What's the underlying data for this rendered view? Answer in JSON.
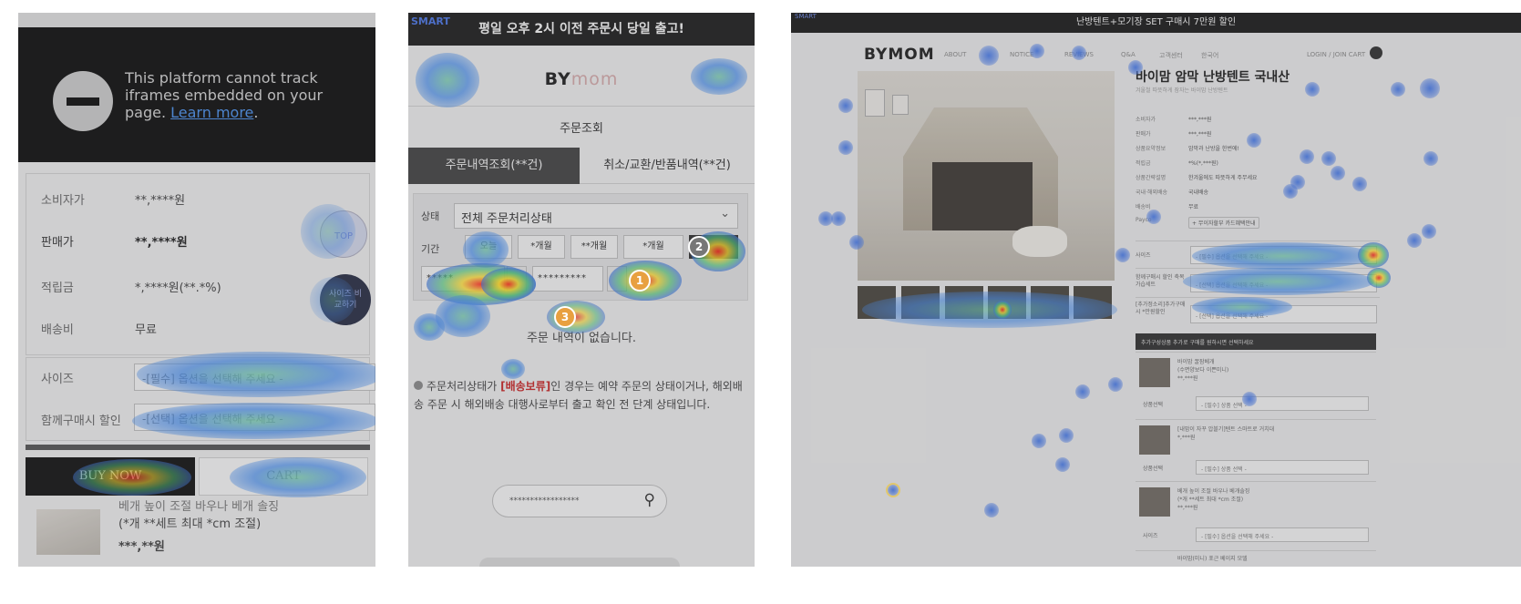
{
  "panel1": {
    "notice_text": "This platform cannot track iframes embedded on your page.",
    "learn_more": "Learn more",
    "notice_period": ".",
    "rows": [
      {
        "label": "소비자가",
        "value": "**,****원"
      },
      {
        "label": "판매가",
        "value": "**,****원"
      },
      {
        "label": "적립금",
        "value": "*,****원(**.*%)"
      },
      {
        "label": "배송비",
        "value": "무료"
      }
    ],
    "top_button": "TOP",
    "size_guide_button": "사이즈 비교하기",
    "options": [
      {
        "label": "사이즈",
        "placeholder": "-[필수] 옵션을 선택해 주세요 -"
      },
      {
        "label": "함께구매시 할인",
        "placeholder": "-[선택] 옵션을 선택해 주세요 -"
      }
    ],
    "buy_now": "BUY NOW",
    "cart": "CART",
    "product_line1": "베개 높이 조절 바우나 베개 솔징",
    "product_line2": "(*개 **세트 최대 *cm 조절)",
    "product_price": "***,**원"
  },
  "panel2": {
    "smart_label": "SMART",
    "banner": "평일 오후 2시 이전 주문시 당일 출고!",
    "logo_bold": "BY",
    "logo_light": "mom",
    "title": "주문조회",
    "tab_orders": "주문내역조회(**건)",
    "tab_cancel": "취소/교환/반품내역(**건)",
    "status_label": "상태",
    "status_value": "전체 주문처리상태",
    "period_label": "기간",
    "period_buttons": [
      "오늘",
      "*개월",
      "**개월",
      "*개월"
    ],
    "date_from": "*****",
    "date_to": "*********",
    "empty_message": "주문 내역이 없습니다.",
    "info_prefix": "주문처리상태가 ",
    "info_highlight": "[배송보류]",
    "info_suffix": "인 경우는 예약 주문의 상태이거나, 해외배송 주문 시 해외배송 대행사로부터 출고 확인 전 단계 상태입니다.",
    "search_placeholder": "*****************",
    "markers": [
      "1",
      "2",
      "3"
    ]
  },
  "panel3": {
    "smart_label": "SMART",
    "topbar": "난방텐트+모기장 SET 구매시 7만원 할인",
    "brand": "BYMOM",
    "nav": [
      "ABOUT",
      "NOTICE",
      "REVIEWS",
      "Q&A",
      "고객센터",
      "한국어"
    ],
    "nav_right": "LOGIN / JOIN  CART",
    "product_title": "바이맘 암막 난방텐트 국내산",
    "product_sub": "겨울철 따뜻하게 잠자는 바이맘 난방텐트",
    "specs": [
      {
        "label": "소비자가",
        "value": "***,***원"
      },
      {
        "label": "판매가",
        "value": "***,***원"
      },
      {
        "label": "상품요약정보",
        "value": "암막과 난방을 한번에!"
      },
      {
        "label": "적립금",
        "value": "*%(*,***원)"
      },
      {
        "label": "상품간략설명",
        "value": "한겨울에도 따뜻하게 주무세요"
      },
      {
        "label": "국내·해외배송",
        "value": "국내배송"
      },
      {
        "label": "배송비",
        "value": "무료"
      },
      {
        "label": "Payco",
        "value": "+ 무이자할부 카드혜택안내"
      }
    ],
    "options": [
      {
        "label": "사이즈",
        "placeholder": "- [필수] 옵션을 선택해 주세요 -"
      },
      {
        "label": "함께구매시 할인 축복가습세트",
        "placeholder": "- [선택] 옵션을 선택해 주세요 -"
      },
      {
        "label": "[추가정소리]추가구매시 *만원할인",
        "placeholder": "- [선택] 옵션을 선택해 주세요 -"
      }
    ],
    "add_header": "추가구성상품 추가로 구매를 원하시면 선택하세요",
    "add_items": [
      {
        "name": "바이맘 꿀잠베개",
        "sub": "(수면양보다 이쁜미니)",
        "price": "**,***원",
        "sel_label": "상품선택",
        "sel": "- [필수] 상품 선택 -"
      },
      {
        "name": "[내맘이 자꾸 압블기]텐트 스마트로 거치대",
        "sub": "",
        "price": "*,***원",
        "sel_label": "상품선택",
        "sel": "- [필수] 상품 선택 -"
      },
      {
        "name": "베개 높이 조절 바우나 베개솔징",
        "sub": "(*개 **세트 최대 *cm 조절)",
        "price": "**,***원",
        "sel_label": "사이즈",
        "sel": "- [필수] 옵션을 선택해 주세요 -"
      },
      {
        "name": "바이맘(미니) 포근 베이지 모델",
        "sub": "",
        "price": "",
        "sel_label": "",
        "sel": ""
      }
    ]
  },
  "colors": {
    "heat_blue": "#4678e6",
    "heat_red": "#ff2820",
    "heat_yellow": "#ffdc28",
    "heat_green": "#50c878",
    "marker_orange": "#e8a040",
    "marker_gray": "#777777"
  }
}
